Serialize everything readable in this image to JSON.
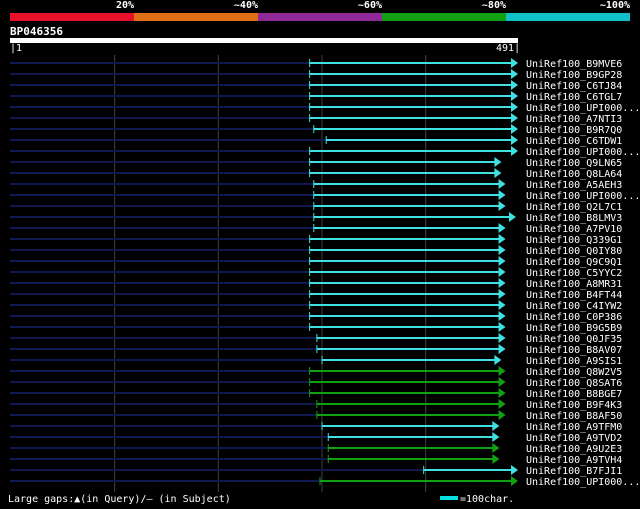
{
  "identity_legend": {
    "labels": [
      "20%",
      "~40%",
      "~60%",
      "~80%",
      "~100%"
    ],
    "colors": [
      "#e8102a",
      "#e07018",
      "#902898",
      "#10a010",
      "#10c0c8"
    ]
  },
  "query": {
    "name": "BP046356",
    "start": "1",
    "end": "491"
  },
  "colors": {
    "cyan": "#40e0e0",
    "green": "#10a010",
    "gap_line": "#101850",
    "grid": "#404040"
  },
  "hits": [
    {
      "name": "UniRef100_B9MVE6",
      "start": 290,
      "end": 491,
      "color": "cyan"
    },
    {
      "name": "UniRef100_B9GP28",
      "start": 290,
      "end": 491,
      "color": "cyan"
    },
    {
      "name": "UniRef100_C6TJ84",
      "start": 290,
      "end": 491,
      "color": "cyan"
    },
    {
      "name": "UniRef100_C6TGL7",
      "start": 290,
      "end": 491,
      "color": "cyan"
    },
    {
      "name": "UniRef100_UPI000...",
      "start": 290,
      "end": 491,
      "color": "cyan"
    },
    {
      "name": "UniRef100_A7NTI3",
      "start": 290,
      "end": 491,
      "color": "cyan"
    },
    {
      "name": "UniRef100_B9R7Q0",
      "start": 294,
      "end": 491,
      "color": "cyan"
    },
    {
      "name": "UniRef100_C6TDW1",
      "start": 306,
      "end": 491,
      "color": "cyan"
    },
    {
      "name": "UniRef100_UPI000...",
      "start": 290,
      "end": 491,
      "color": "cyan"
    },
    {
      "name": "UniRef100_Q9LN65",
      "start": 290,
      "end": 475,
      "color": "cyan"
    },
    {
      "name": "UniRef100_Q8LA64",
      "start": 290,
      "end": 475,
      "color": "cyan"
    },
    {
      "name": "UniRef100_A5AEH3",
      "start": 294,
      "end": 479,
      "color": "cyan"
    },
    {
      "name": "UniRef100_UPI000...",
      "start": 294,
      "end": 479,
      "color": "cyan"
    },
    {
      "name": "UniRef100_Q2L7C1",
      "start": 294,
      "end": 479,
      "color": "cyan"
    },
    {
      "name": "UniRef100_B8LMV3",
      "start": 294,
      "end": 489,
      "color": "cyan"
    },
    {
      "name": "UniRef100_A7PV10",
      "start": 294,
      "end": 479,
      "color": "cyan"
    },
    {
      "name": "UniRef100_Q339G1",
      "start": 290,
      "end": 479,
      "color": "cyan"
    },
    {
      "name": "UniRef100_Q0IY80",
      "start": 290,
      "end": 479,
      "color": "cyan"
    },
    {
      "name": "UniRef100_Q9C9Q1",
      "start": 290,
      "end": 479,
      "color": "cyan"
    },
    {
      "name": "UniRef100_C5YYC2",
      "start": 290,
      "end": 479,
      "color": "cyan"
    },
    {
      "name": "UniRef100_A8MR31",
      "start": 290,
      "end": 479,
      "color": "cyan"
    },
    {
      "name": "UniRef100_B4FT44",
      "start": 290,
      "end": 479,
      "color": "cyan"
    },
    {
      "name": "UniRef100_C4IYW2",
      "start": 290,
      "end": 479,
      "color": "cyan"
    },
    {
      "name": "UniRef100_C0P386",
      "start": 290,
      "end": 479,
      "color": "cyan"
    },
    {
      "name": "UniRef100_B9G5B9",
      "start": 290,
      "end": 479,
      "color": "cyan"
    },
    {
      "name": "UniRef100_Q0JF35",
      "start": 297,
      "end": 479,
      "color": "cyan"
    },
    {
      "name": "UniRef100_B8AV07",
      "start": 297,
      "end": 479,
      "color": "cyan"
    },
    {
      "name": "UniRef100_A9SIS1",
      "start": 302,
      "end": 475,
      "color": "cyan"
    },
    {
      "name": "UniRef100_Q8W2V5",
      "start": 290,
      "end": 479,
      "color": "green"
    },
    {
      "name": "UniRef100_Q8SAT6",
      "start": 290,
      "end": 479,
      "color": "green"
    },
    {
      "name": "UniRef100_B8BGE7",
      "start": 290,
      "end": 479,
      "color": "green"
    },
    {
      "name": "UniRef100_B9F4K3",
      "start": 297,
      "end": 479,
      "color": "green"
    },
    {
      "name": "UniRef100_B8AF50",
      "start": 297,
      "end": 479,
      "color": "green"
    },
    {
      "name": "UniRef100_A9TFM0",
      "start": 302,
      "end": 473,
      "color": "cyan"
    },
    {
      "name": "UniRef100_A9TVD2",
      "start": 308,
      "end": 473,
      "color": "cyan"
    },
    {
      "name": "UniRef100_A9U2E3",
      "start": 308,
      "end": 473,
      "color": "green"
    },
    {
      "name": "UniRef100_A9TVH4",
      "start": 308,
      "end": 473,
      "color": "green"
    },
    {
      "name": "UniRef100_B7FJI1",
      "start": 400,
      "end": 491,
      "color": "cyan"
    },
    {
      "name": "UniRef100_UPI000...",
      "start": 300,
      "end": 491,
      "color": "green"
    }
  ],
  "footer": {
    "large_gaps_text": "Large gaps:▲(in Query)/– (in Subject)",
    "scale_label": "=100char."
  }
}
